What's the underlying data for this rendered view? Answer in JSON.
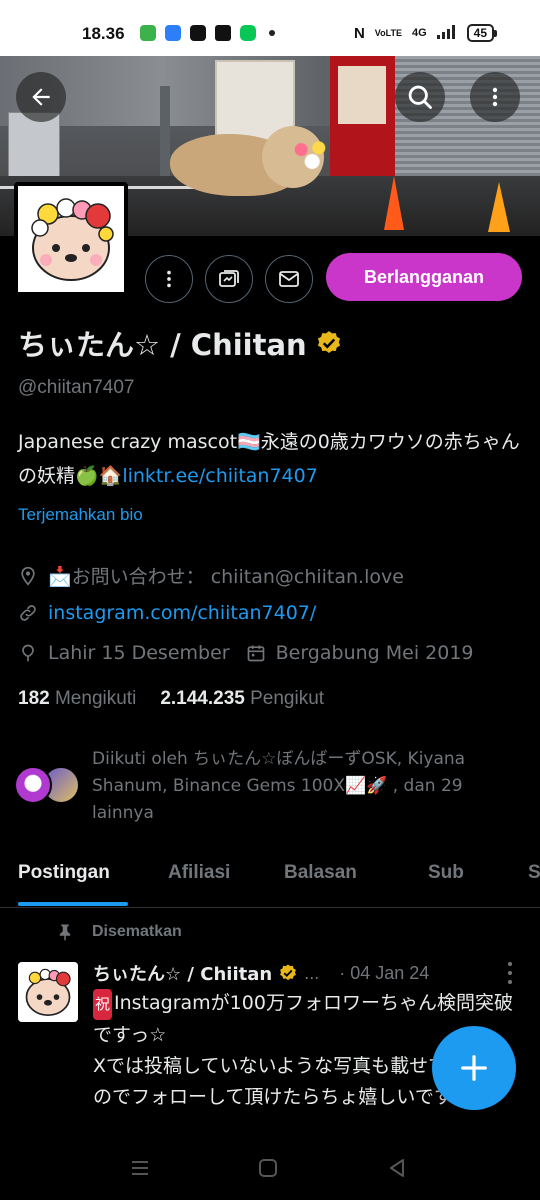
{
  "status_bar": {
    "time": "18.36",
    "network": "4G",
    "volte": "VoLTE",
    "battery": "45"
  },
  "profile": {
    "display_name": "ちぃたん☆ / Chiitan",
    "handle": "@chiitan7407",
    "subscribe_label": "Berlangganan",
    "bio_text": "Japanese crazy mascot🏳️‍⚧️永遠の0歳カワウソの赤ちゃんの妖精🍏🏠",
    "bio_link": "linktr.ee/chiitan7407",
    "translate_label": "Terjemahkan bio",
    "contact": "📩お問い合わせ：  chiitan@chiitan.love",
    "website": "instagram.com/chiitan7407/",
    "birthday": "Lahir 15 Desember",
    "joined": "Bergabung Mei 2019",
    "following_count": "182",
    "following_label": "Mengikuti",
    "followers_count": "2.144.235",
    "followers_label": "Pengikut",
    "followed_by": "Diikuti oleh ちぃたん☆ぼんばーずOSK, Kiyana Shanum, Binance Gems 100X📈🚀 , dan 29 lainnya"
  },
  "tabs": [
    {
      "label": "Postingan"
    },
    {
      "label": "Afiliasi"
    },
    {
      "label": "Balasan"
    },
    {
      "label": "Sub"
    },
    {
      "label": "S"
    }
  ],
  "pinned_post": {
    "pinned_label": "Disematkan",
    "author_name": "ちぃたん☆ / Chiitan",
    "author_ellipsis": "...",
    "date": "· 04 Jan 24",
    "badge": "祝",
    "text": "Instagramが100万フォロワーちゃん検問突破ですっ☆\nXでは投稿していないような写真も載せていますのでフォローして頂けたらちょ嬉しいですっ☆"
  },
  "colors": {
    "accent": "#1d9bf0",
    "subscribe": "#c936c9",
    "verified": "#e8b71a",
    "muted": "#71767b"
  },
  "icons": [
    "back-arrow-icon",
    "search-icon",
    "more-vert-icon",
    "dm-message-icon",
    "mail-icon",
    "location-icon",
    "link-icon",
    "birthday-icon",
    "calendar-icon",
    "pin-icon",
    "verified-badge-icon",
    "plus-icon"
  ]
}
